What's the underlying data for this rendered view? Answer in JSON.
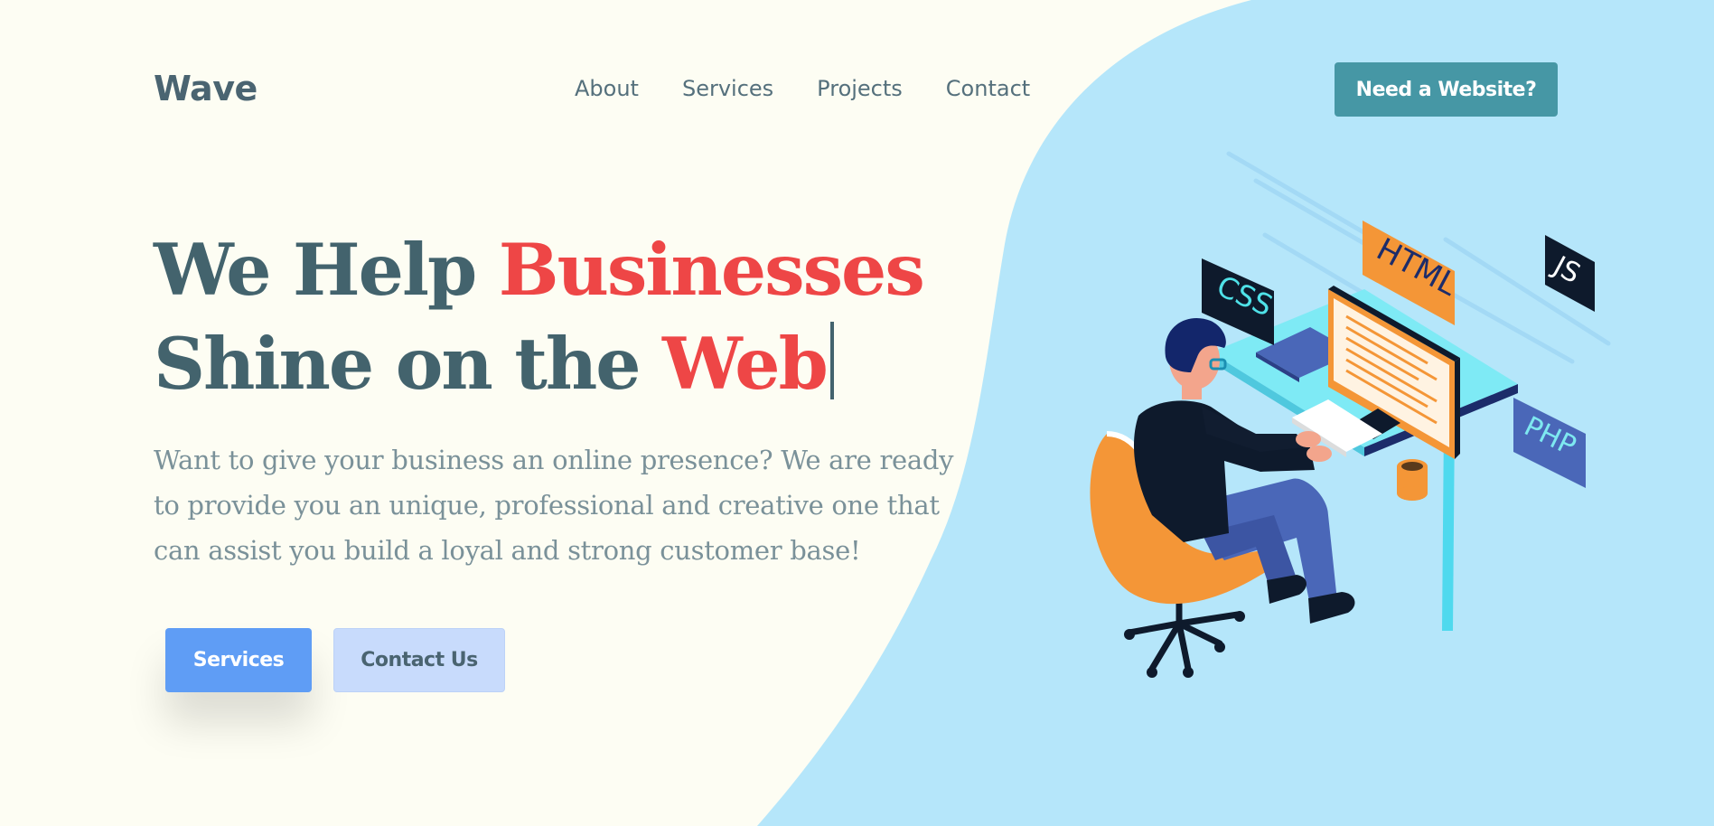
{
  "brand": {
    "logo": "Wave"
  },
  "nav": {
    "items": [
      "About",
      "Services",
      "Projects",
      "Contact"
    ]
  },
  "header": {
    "cta_label": "Need a Website?"
  },
  "hero": {
    "headline_part1": "We Help ",
    "headline_accent1": "Businesses",
    "headline_part2": "Shine on the ",
    "headline_accent2": "Web",
    "subtext": "Want to give your business an online presence? We are ready to provide you an unique, professional and creative one that can assist you build a loyal and strong customer base!",
    "primary_button": "Services",
    "secondary_button": "Contact Us"
  },
  "illustration": {
    "tags": {
      "html": "HTML",
      "css": "CSS",
      "js": "JS",
      "php": "PHP"
    }
  },
  "colors": {
    "background": "#fdfdf3",
    "blob": "#b5e6fa",
    "heading": "#43636d",
    "accent": "#ee4646",
    "cta": "#4697a5",
    "primary_button": "#5f9df5",
    "secondary_button": "#c8dbfc"
  },
  "icons": [
    "developer-illustration"
  ]
}
